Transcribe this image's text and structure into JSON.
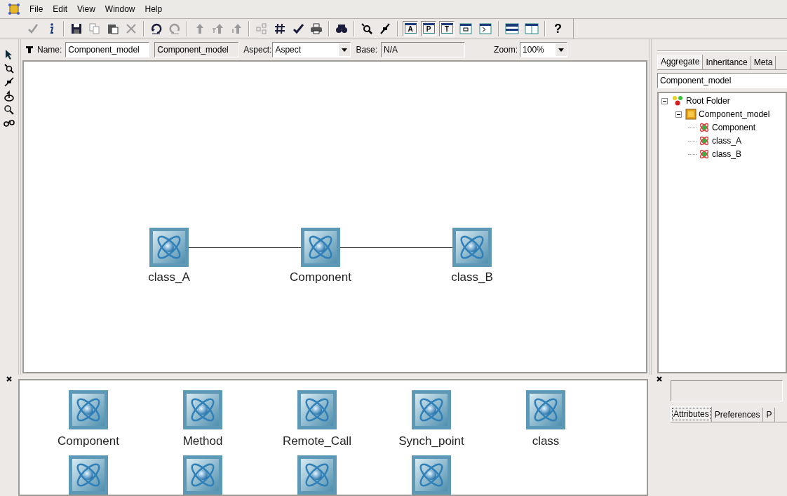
{
  "menu": [
    "File",
    "Edit",
    "View",
    "Window",
    "Help"
  ],
  "toolbar": {
    "panel_buttons": [
      {
        "label": "A",
        "selected": true
      },
      {
        "label": "P",
        "selected": true
      },
      {
        "label": "T",
        "selected": true
      }
    ],
    "help": "?"
  },
  "model_bar": {
    "name_label": "Name:",
    "name_value": "Component_model",
    "kind_value": "Component_model",
    "aspect_label": "Aspect:",
    "aspect_value": "Aspect",
    "base_label": "Base:",
    "base_value": "N/A",
    "zoom_label": "Zoom:",
    "zoom_value": "100%"
  },
  "canvas": {
    "nodes": [
      {
        "label": "class_A",
        "connected_to_next": true
      },
      {
        "label": "Component",
        "connected_to_next": true
      },
      {
        "label": "class_B"
      }
    ]
  },
  "browser": {
    "tabs": [
      {
        "label": "Aggregate",
        "selected": true
      },
      {
        "label": "Inheritance",
        "selected": false
      },
      {
        "label": "Meta",
        "selected": false
      }
    ],
    "filter": "Component_model",
    "tree": [
      {
        "label": "Root Folder",
        "kind": "root",
        "expanded": true,
        "children": [
          {
            "label": "Component_model",
            "kind": "model",
            "expanded": true,
            "children": [
              {
                "label": "Component",
                "kind": "atom"
              },
              {
                "label": "class_A",
                "kind": "atom"
              },
              {
                "label": "class_B",
                "kind": "atom"
              }
            ]
          }
        ]
      }
    ]
  },
  "part_browser": {
    "parts": [
      "Component",
      "Method",
      "Remote_Call",
      "Synch_point",
      "class"
    ],
    "second_row_parts_visible": true
  },
  "attributes": {
    "tabs": [
      {
        "label": "Attributes",
        "selected": true
      },
      {
        "label": "Preferences",
        "selected": false
      },
      {
        "label": "P",
        "selected": false
      }
    ]
  }
}
